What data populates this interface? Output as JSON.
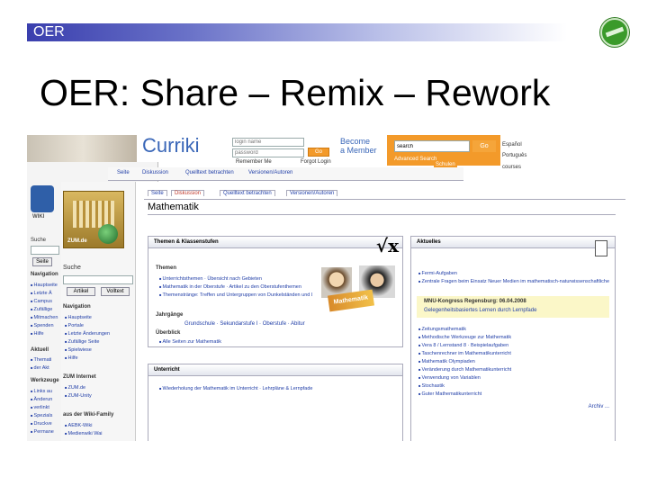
{
  "slide": {
    "header_label": "OER",
    "title": "OER: Share – Remix – Rework"
  },
  "curriki": {
    "logo": "Curriki",
    "login_placeholder": "login name",
    "password_placeholder": "password",
    "go": "Go",
    "remember": "Remember Me",
    "forgot": "Forgot Login",
    "become": "Become",
    "a_member": "a Member",
    "search_value": "search",
    "search_go": "Go",
    "advanced": "Advanced Search",
    "lang1": "Español",
    "lang2": "Português",
    "courses": "courses",
    "schulen": "Schulen",
    "bg_tabs": [
      "Seite",
      "Diskussion",
      "Quelltext betrachten",
      "Versionen/Autoren"
    ]
  },
  "wiki_bg": {
    "logo": "WIKI",
    "suche": "Suche",
    "seite": "Seite",
    "navigation": "Navigation",
    "nav_items": [
      "Hauptseite",
      "Letzte Ä",
      "Campus",
      "Zufällige",
      "Mitmachen",
      "Spenden",
      "Hilfe"
    ],
    "aktuell": "Aktuell",
    "aktuell_items": [
      "Themati",
      "der Akt"
    ],
    "werkzeuge": "Werkzeuge",
    "werkzeuge_items": [
      "Links au",
      "Änderun",
      "verlinkt",
      "Spezials",
      "Druckve",
      "Permane"
    ]
  },
  "zum": {
    "logo_caption": "ZUM.de",
    "suche": "Suche",
    "artikel": "Artikel",
    "volltext": "Volltext",
    "navigation": "Navigation",
    "nav_items": [
      "Hauptseite",
      "Portale",
      "Letzte Änderungen",
      "Zufällige Seite",
      "Spielwiese",
      "Hilfe"
    ],
    "internet": "ZUM Internet",
    "internet_items": [
      "ZUM.de",
      "ZUM-Unity"
    ],
    "family": "aus der Wiki-Family",
    "family_items": [
      "AEBK-Wiki",
      "Medienwiki Wai"
    ],
    "tabs": [
      "Seite",
      "Diskussion",
      "Quelltext betrachten",
      "Versionen/Autoren"
    ],
    "page_title": "Mathematik",
    "themen_heading": "Themen & Klassenstufen",
    "themen_label": "Themen",
    "themen_items": [
      "Unterrichtsthemen · Übersicht nach Gebieten",
      "Mathematik in der Oberstufe · Artikel zu den Oberstufenthemen",
      "Themenstränge: Treffen und Untergruppen von Dunkelständen und Lehrbüchern als gemeinsame Einordnung"
    ],
    "jahrgange_label": "Jahrgänge",
    "jahrgange_value": "Grundschule · Sekundarstufe I · Oberstufe · Abitur",
    "uberblick_label": "Überblick",
    "uberblick_item": "Alle Seiten zur Mathematik",
    "unterricht_heading": "Unterricht",
    "unterricht_item": "Wiederholung der Mathematik im Unterricht · Lehrpläne & Lernpfade",
    "sqrt_symbol": "√x",
    "aktuelles_heading": "Aktuelles",
    "aktuelles_items": [
      "Fermi-Aufgaben",
      "Zentrale Fragen beim Einsatz Neuer Medien im mathematisch-naturwissenschaftlichen Unterricht"
    ],
    "mnu_item": "MNU-Kongress Regensburg: 06.04.2008",
    "mnu_sub": "Gelegenheitsbasiertes Lernen durch Lernpfade",
    "aktuelles_more": [
      "Zeitungsmathematik",
      "Methodische Werkzeuge zur Mathematik",
      "Vera 8 / Lernstand 8 · Beispielaufgaben",
      "Taschenrechner im Mathematikunterricht",
      "Mathematik Olympiaden",
      "Veränderung durch Mathematikunterricht",
      "Verwendung von Variablen",
      "Stochastik",
      "Guter Mathematikunterricht"
    ],
    "mathematik_image_label": "Mathematik",
    "footer_link": "Archiv ..."
  }
}
